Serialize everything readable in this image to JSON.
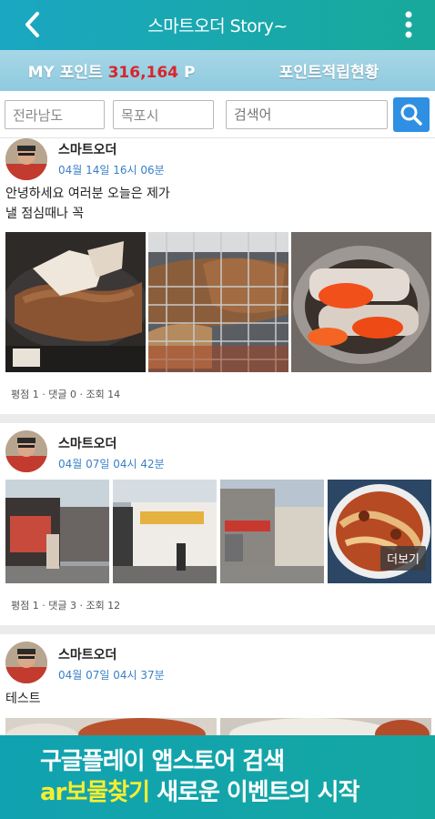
{
  "header": {
    "title": "스마트오더 Story~"
  },
  "points": {
    "label": "MY 포인트",
    "value": "316,164",
    "unit": "P",
    "history_label": "포인트적립현황"
  },
  "search": {
    "province": "전라남도",
    "city": "목포시",
    "placeholder": "검색어"
  },
  "posts": [
    {
      "author": "스마트오더",
      "date": "04월 14일 16시 06분",
      "text_line1": "안녕하세요 여러분 오늘은 제가",
      "text_line2": "낼 점심때나 꼭",
      "stats": "평점 1 · 댓글 0 · 조회 14"
    },
    {
      "author": "스마트오더",
      "date": "04월 07일 04시 42분",
      "more_label": "더보기",
      "stats": "평점 1 · 댓글 3 · 조회 12"
    },
    {
      "author": "스마트오더",
      "date": "04월 07일 04시 37분",
      "text_line1": "테스트"
    }
  ],
  "banner": {
    "line1": "구글플레이 앱스토어 검색",
    "highlight": "ar보물찾기",
    "line2_rest": " 새로운 이벤트의 시작"
  },
  "colors": {
    "header": "#1aa7c2",
    "points_value": "#d8262c",
    "date": "#3a80c8",
    "search_button": "#2e8fe3",
    "banner": "#11a2b1",
    "banner_highlight": "#f7ee2f"
  }
}
